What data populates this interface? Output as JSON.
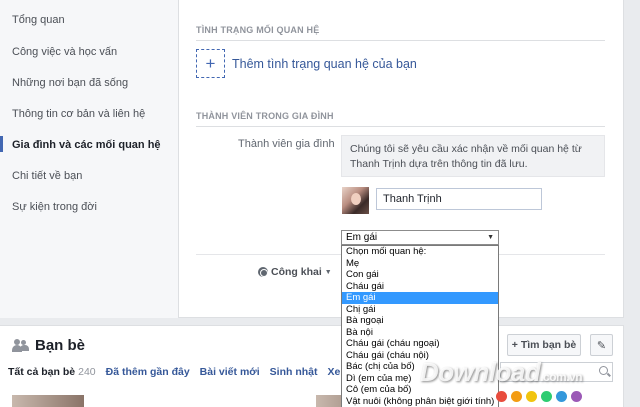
{
  "sidebar": {
    "items": [
      {
        "label": "Tổng quan"
      },
      {
        "label": "Công việc và học vấn"
      },
      {
        "label": "Những nơi bạn đã sống"
      },
      {
        "label": "Thông tin cơ bản và liên hệ"
      },
      {
        "label": "Gia đình và các mối quan hệ",
        "active": true
      },
      {
        "label": "Chi tiết về bạn"
      },
      {
        "label": "Sự kiện trong đời"
      }
    ]
  },
  "relationship": {
    "heading": "TÌNH TRẠNG MỐI QUAN HỆ",
    "add_icon": "+",
    "add_label": "Thêm tình trạng quan hệ của bạn"
  },
  "family": {
    "heading": "THÀNH VIÊN TRONG GIA ĐÌNH",
    "member_label": "Thành viên gia đình",
    "info_text": "Chúng tôi sẽ yêu cầu xác nhận về mối quan hệ từ Thanh Trịnh dựa trên thông tin đã lưu.",
    "name_value": "Thanh Trịnh",
    "select_value": "Em gái",
    "options": [
      "Chọn mối quan hệ:",
      "Mẹ",
      "Con gái",
      "Cháu gái",
      "Em gái",
      "Chị gái",
      "Bà ngoại",
      "Bà nội",
      "Cháu gái (cháu ngoại)",
      "Cháu gái (cháu nội)",
      "Bác (chị của bố)",
      "Dì (em của mẹ)",
      "Cô (em của bố)",
      "Vật nuôi (không phân biệt giới tính)"
    ],
    "selected_index": 4,
    "privacy_label": "Công khai"
  },
  "friends": {
    "title": "Bạn bè",
    "find_button": "Tìm bạn bè",
    "find_icon": "+",
    "edit_icon": "pencil-icon",
    "tabs": [
      {
        "label": "Tất cả bạn bè",
        "count": "240"
      },
      {
        "label": "Đã thêm gần đây"
      },
      {
        "label": "Bài viết mới"
      },
      {
        "label": "Sinh nhật"
      },
      {
        "label": "Xem t"
      }
    ]
  },
  "watermark": {
    "text": "Download",
    "suffix": ".com.vn",
    "colors": [
      "#e84c3d",
      "#f39c12",
      "#f1c40f",
      "#2ecc71",
      "#3498db",
      "#9b59b6"
    ]
  },
  "colors": {
    "link": "#365899",
    "accent": "#4267b2",
    "selected_option": "#3399ff"
  }
}
